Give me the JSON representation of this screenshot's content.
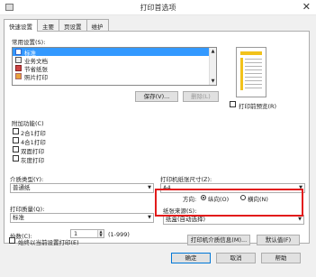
{
  "window": {
    "title": "打印首选项",
    "close_glyph": "✕"
  },
  "tabs": [
    "快速设置",
    "主要",
    "页设置",
    "维护"
  ],
  "common_settings": {
    "label": "常用设置(S):",
    "items": [
      {
        "label": "标准",
        "icon": "standard-doc-icon",
        "selected": true
      },
      {
        "label": "业务文档",
        "icon": "business-doc-icon",
        "selected": false
      },
      {
        "label": "节省纸张",
        "icon": "save-paper-icon",
        "selected": false
      },
      {
        "label": "照片打印",
        "icon": "photo-print-icon",
        "selected": false
      }
    ],
    "save_button": "保存(V)...",
    "delete_button": "删除(L)"
  },
  "preview": {
    "checkbox_label": "打印前预览(R)"
  },
  "additional": {
    "label": "附加功能(C)",
    "options": [
      "2合1打印",
      "4合1打印",
      "双面打印",
      "灰度打印"
    ]
  },
  "media_type": {
    "label": "介质类型(Y):",
    "value": "普通纸"
  },
  "paper_size": {
    "label": "打印机纸张尺寸(Z):",
    "value": "A4"
  },
  "orientation": {
    "label": "方向:",
    "portrait_label": "纵向(O)",
    "landscape_label": "横向(N)",
    "selected": "portrait"
  },
  "print_quality": {
    "label": "打印质量(Q):",
    "value": "标准"
  },
  "paper_source": {
    "label": "纸张来源(S):",
    "value": "纸盒(自动选择)"
  },
  "copies": {
    "label": "份数(C):",
    "value": "1",
    "range": "(1-999)"
  },
  "always_current": {
    "label": "始终以当前设置打印(E)"
  },
  "buttons": {
    "printer_info": "打印机介质信息(M)...",
    "defaults": "默认值(F)",
    "ok": "确定",
    "cancel": "取消",
    "help": "帮助"
  }
}
